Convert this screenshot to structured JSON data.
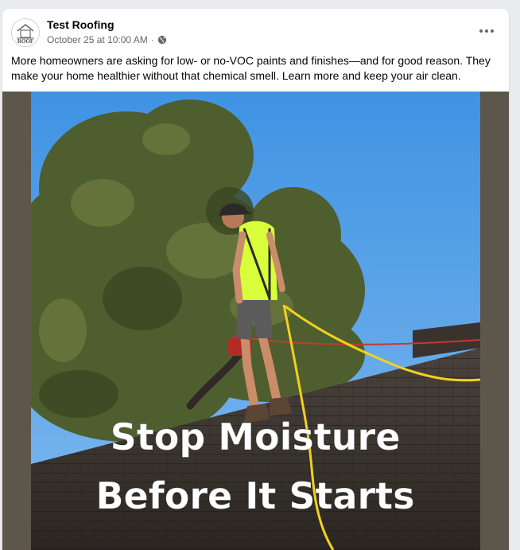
{
  "post": {
    "page_name": "Test Roofing",
    "timestamp": "October 25 at 10:00 AM",
    "separator": "·",
    "audience_icon": "globe-icon",
    "more_icon": "more-horizontal-icon",
    "avatar_text": "ROOF",
    "caption": "More homeowners are asking for low- or no-VOC paints and finishes—and for good reason. They make your home healthier without that chemical smell. Learn more and keep your air clean.",
    "image": {
      "overlay_line_1": "Stop Moisture",
      "overlay_line_2": "Before It Starts"
    }
  },
  "colors": {
    "sky": "#4a9be6",
    "shingles": "#3a3530",
    "shirt": "#d8ff3a",
    "rope": "#f2d022",
    "frame": "#5d564a"
  }
}
